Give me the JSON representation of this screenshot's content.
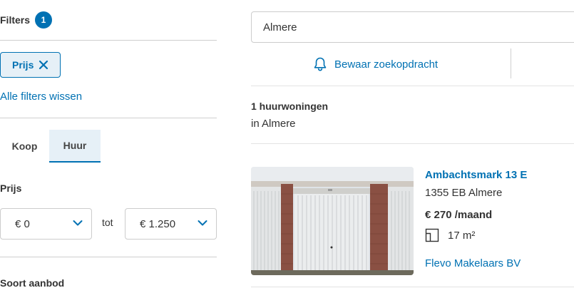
{
  "filters": {
    "title": "Filters",
    "active_count": "1",
    "active_chip": {
      "label": "Prijs",
      "icon": "close-icon"
    },
    "clear_all_label": "Alle filters wissen",
    "tabs": [
      {
        "label": "Koop",
        "active": false
      },
      {
        "label": "Huur",
        "active": true
      }
    ],
    "price": {
      "label": "Prijs",
      "min_value": "€ 0",
      "separator": "tot",
      "max_value": "€ 1.250"
    },
    "offer_type_label": "Soort aanbod"
  },
  "search": {
    "value": "Almere",
    "save_search_label": "Bewaar zoekopdracht",
    "save_search_icon": "bell-icon"
  },
  "results": {
    "count_label": "1 huurwoningen",
    "location_label": "in Almere",
    "listings": [
      {
        "title": "Ambachtsmark 13 E",
        "postcode_city": "1355 EB Almere",
        "price": "€ 270 /maand",
        "area": "17 m²",
        "agent": "Flevo Makelaars BV",
        "image_alt": "garage-photo"
      }
    ]
  },
  "colors": {
    "accent": "#0071b3",
    "accent_light": "#e6f0f7",
    "text": "#333333",
    "border": "#cccccc"
  }
}
